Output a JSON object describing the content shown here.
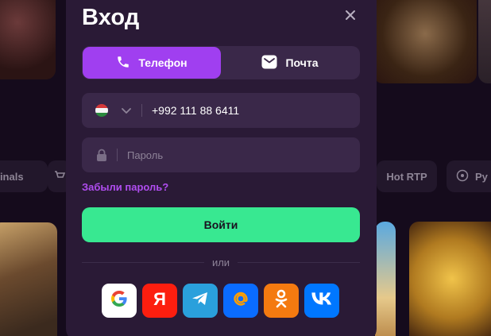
{
  "background": {
    "chips": {
      "originals": "ginals",
      "hot_rtp": "Hot RTP",
      "partial": "Py"
    }
  },
  "modal": {
    "title": "Вход",
    "tabs": [
      {
        "label": "Телефон",
        "icon": "phone-icon",
        "active": true
      },
      {
        "label": "Почта",
        "icon": "mail-icon",
        "active": false
      }
    ],
    "phone": {
      "country_flag": "Tajikistan",
      "value": "+992 111 88 6411"
    },
    "password": {
      "placeholder": "Пароль"
    },
    "forgot_label": "Забыли пароль?",
    "login_label": "Войти",
    "or_label": "или",
    "socials": [
      "Google",
      "Яндекс",
      "Telegram",
      "Mail.ru",
      "Одноклассники",
      "VK"
    ]
  },
  "colors": {
    "accent_purple": "#a03ff0",
    "login_green": "#38e891",
    "modal_bg": "#2a1a36",
    "field_bg": "#3a2849"
  }
}
